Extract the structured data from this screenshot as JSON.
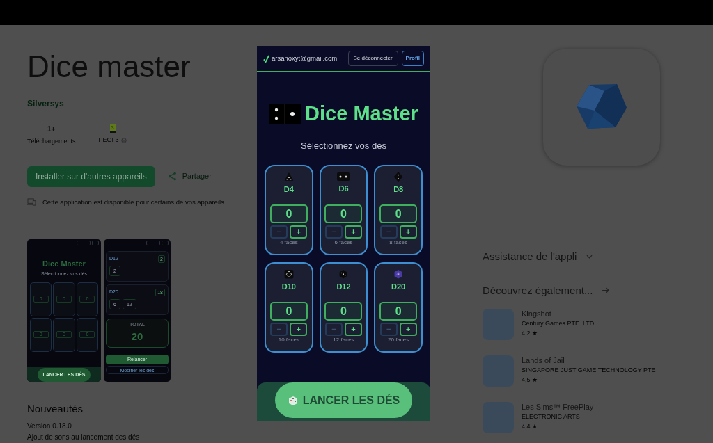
{
  "app": {
    "title": "Dice master",
    "developer": "Silversys",
    "stats": [
      {
        "kind": "count",
        "value": "1+",
        "label": "Téléchargements"
      },
      {
        "kind": "rating",
        "value": "3",
        "label": "PEGI 3"
      }
    ],
    "install_button": "Installer sur d'autres appareils",
    "share_button": "Partager",
    "availability": "Cette application est disponible pour certains de vos appareils"
  },
  "screenshots": [
    {
      "kind": "picker",
      "title": "Dice Master",
      "subtitle": "Sélectionnez vos dés",
      "counts": [
        "0",
        "0",
        "0",
        "0",
        "0",
        "0"
      ],
      "roll_button": "LANCER LES DÉS"
    },
    {
      "kind": "results",
      "groups": [
        {
          "name": "D12",
          "sum": "2",
          "rolls": [
            "2"
          ]
        },
        {
          "name": "D20",
          "sum": "18",
          "rolls": [
            "6",
            "12"
          ]
        }
      ],
      "total_label": "TOTAL",
      "total": "20",
      "reroll_button": "Relancer",
      "edit_button": "Modifier les dés"
    }
  ],
  "whats_new": {
    "title": "Nouveautés",
    "version": "Version 0.18.0",
    "text": "Ajout de sons au lancement des dés"
  },
  "app_support": {
    "title": "Assistance de l'appli",
    "expanded": false
  },
  "similar": {
    "title": "Découvrez également...",
    "apps": [
      {
        "name": "Kingshot",
        "developer": "Century Games PTE. LTD.",
        "rating": "4,2 ★"
      },
      {
        "name": "Lands of Jail",
        "developer": "SINGAPORE JUST GAME TECHNOLOGY PTE",
        "rating": "4,5 ★"
      },
      {
        "name": "Les Sims™ FreePlay",
        "developer": "ELECTRONIC ARTS",
        "rating": "4,4 ★"
      }
    ]
  },
  "preview": {
    "email": "arsanoxyt@gmail.com",
    "buttons": [
      {
        "kind": "outline",
        "label": "Se déconnecter"
      },
      {
        "kind": "primary",
        "label": "Profil"
      }
    ],
    "title": "Dice Master",
    "subtitle": "Sélectionnez vos dés",
    "dice": [
      {
        "kind": "d4",
        "name": "D4",
        "count": "0",
        "minus": "−",
        "plus": "+",
        "decrement_enabled": false,
        "faces": "4 faces"
      },
      {
        "kind": "d6",
        "name": "D6",
        "count": "0",
        "minus": "−",
        "plus": "+",
        "decrement_enabled": false,
        "faces": "6 faces"
      },
      {
        "kind": "d8",
        "name": "D8",
        "count": "0",
        "minus": "−",
        "plus": "+",
        "decrement_enabled": false,
        "faces": "8 faces"
      },
      {
        "kind": "d10",
        "name": "D10",
        "count": "0",
        "minus": "−",
        "plus": "+",
        "decrement_enabled": false,
        "faces": "10 faces"
      },
      {
        "kind": "d12",
        "name": "D12",
        "count": "0",
        "minus": "−",
        "plus": "+",
        "decrement_enabled": false,
        "faces": "12 faces"
      },
      {
        "kind": "d20",
        "name": "D20",
        "count": "0",
        "minus": "−",
        "plus": "+",
        "decrement_enabled": false,
        "faces": "20 faces"
      }
    ],
    "roll_button": "LANCER LES DÉS"
  }
}
